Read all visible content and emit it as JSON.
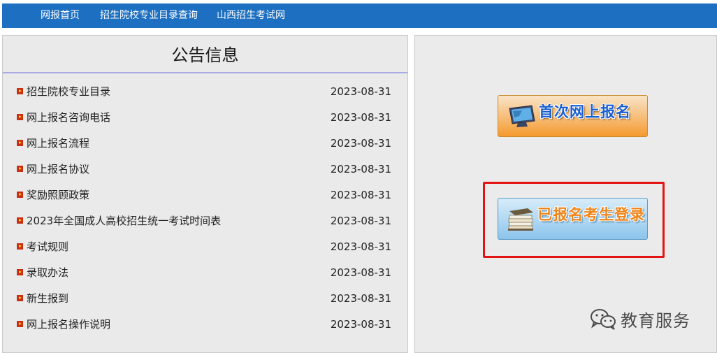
{
  "nav": {
    "items": [
      {
        "label": "网报首页"
      },
      {
        "label": "招生院校专业目录查询"
      },
      {
        "label": "山西招生考试网"
      }
    ]
  },
  "notice": {
    "title": "公告信息",
    "items": [
      {
        "title": "招生院校专业目录",
        "date": "2023-08-31"
      },
      {
        "title": "网上报名咨询电话",
        "date": "2023-08-31"
      },
      {
        "title": "网上报名流程",
        "date": "2023-08-31"
      },
      {
        "title": "网上报名协议",
        "date": "2023-08-31"
      },
      {
        "title": "奖励照顾政策",
        "date": "2023-08-31"
      },
      {
        "title": "2023年全国成人高校招生统一考试时间表",
        "date": "2023-08-31"
      },
      {
        "title": "考试规则",
        "date": "2023-08-31"
      },
      {
        "title": "录取办法",
        "date": "2023-08-31"
      },
      {
        "title": "新生报到",
        "date": "2023-08-31"
      },
      {
        "title": "网上报名操作说明",
        "date": "2023-08-31"
      }
    ]
  },
  "actions": {
    "first_signup": "首次网上报名",
    "registered_login": "已报名考生登录"
  },
  "watermark": {
    "text": "教育服务"
  },
  "colors": {
    "nav_bg": "#1c6fc1",
    "panel_bg": "#eaeaea",
    "highlight": "#e51414",
    "first_signup_text": "#1a5fd0",
    "login_text": "#f08418"
  },
  "icons": {
    "bullet": "arrow-bullet-icon",
    "first_signup": "monitor-icon",
    "login": "book-stack-icon",
    "watermark": "wechat-icon"
  }
}
